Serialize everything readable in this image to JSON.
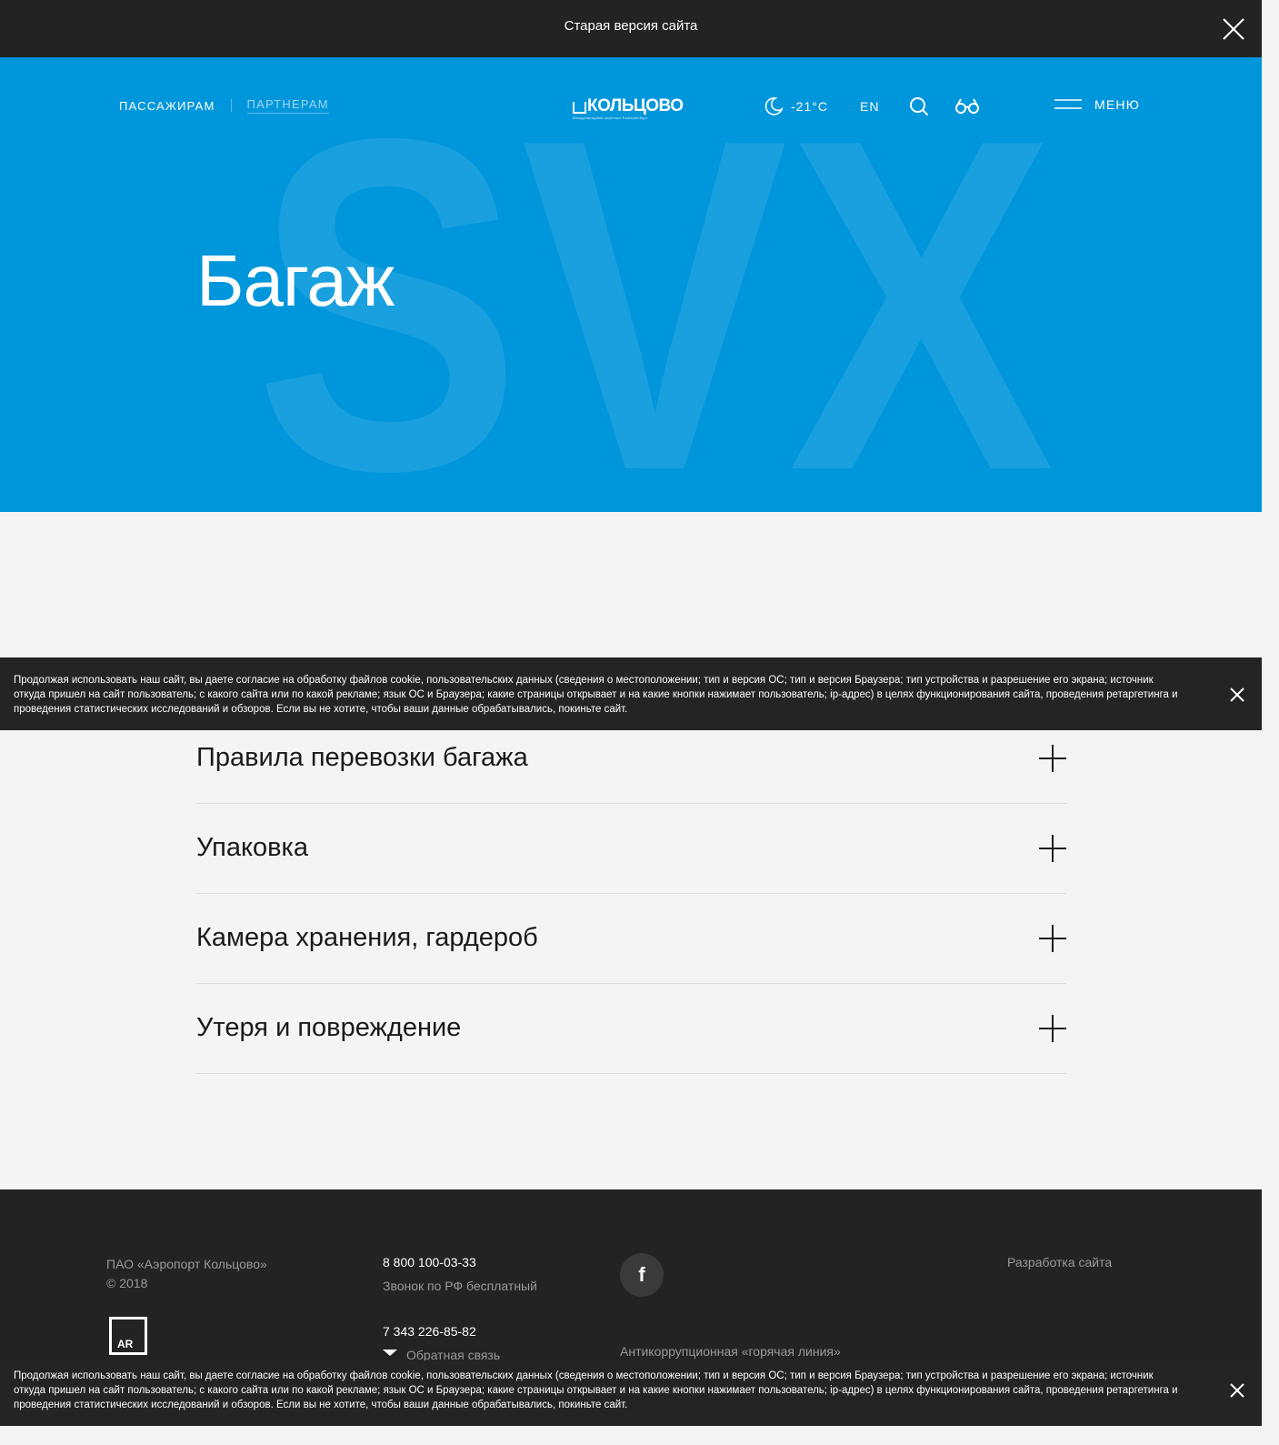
{
  "topbar": {
    "title": "Старая версия сайта"
  },
  "header": {
    "nav": {
      "passengers": "ПАССАЖИРАМ",
      "partners": "ПАРТНЕРАМ"
    },
    "logo": {
      "word": "КОЛЬЦОВО",
      "tagline": "Международный аэропорт Екатеринбург"
    },
    "weather": {
      "temperature": "-21°C",
      "icon": "moon-icon"
    },
    "language": "EN",
    "menu_label": "МЕНЮ",
    "background_letters": "SVX"
  },
  "hero": {
    "title": "Багаж"
  },
  "accordion": {
    "items": [
      {
        "label": "Правила перевозки багажа"
      },
      {
        "label": "Упаковка"
      },
      {
        "label": "Камера хранения, гардероб"
      },
      {
        "label": "Утеря и повреждение"
      }
    ]
  },
  "cookie_notice": {
    "text": "Продолжая использовать наш сайт, вы даете согласие на обработку файлов cookie, пользовательских данных (сведения о местоположении; тип и версия ОС; тип и версия Браузера; тип устройства и разрешение его экрана; источник откуда пришел на сайт пользователь; с какого сайта или по какой рекламе; язык ОС и Браузера; какие страницы открывает и на какие кнопки нажимает пользователь; ip-адрес) в целях функционирования сайта, проведения ретаргетинга и проведения статистических исследований и обзоров. Если вы не хотите, чтобы ваши данные обрабатывались, покиньте сайт."
  },
  "footer": {
    "company": "ПАО «Аэропорт Кольцово»",
    "copyright": "© 2018",
    "badge": "AR",
    "phone_1": "8 800 100-03-33",
    "phone_1_note": "Звонок по РФ бесплатный",
    "phone_2": "7 343 226-85-82",
    "feedback": "Обратная связь",
    "social": "f",
    "hotline": "Антикоррупционная «горячая линия»",
    "developer": "Разработка сайта"
  },
  "colors": {
    "hero_bg": "#0096db",
    "dark_bar": "#232323",
    "content_bg": "#f4f4f4"
  }
}
